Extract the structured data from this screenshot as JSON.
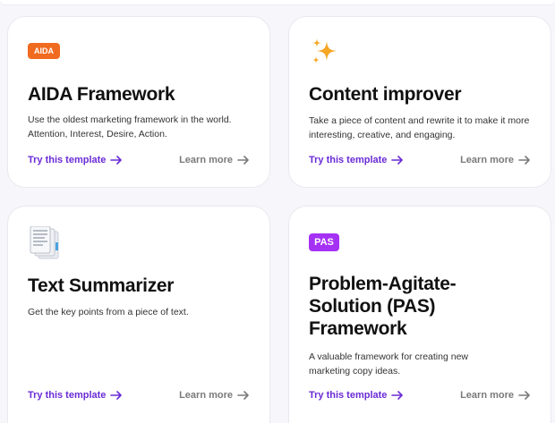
{
  "cards": [
    {
      "badge": "AIDA",
      "icon": "aida-badge-icon",
      "title": "AIDA Framework",
      "description": "Use the oldest marketing framework in the world. Attention, Interest, Desire, Action.",
      "try_label": "Try this template",
      "learn_label": "Learn more"
    },
    {
      "icon": "sparkles-icon",
      "title": "Content improver",
      "description": "Take a piece of content and rewrite it to make it more interesting, creative, and engaging.",
      "try_label": "Try this template",
      "learn_label": "Learn more"
    },
    {
      "icon": "document-stack-icon",
      "title": "Text Summarizer",
      "description": "Get the key points from a piece of text.",
      "try_label": "Try this template",
      "learn_label": "Learn more"
    },
    {
      "badge": "PAS",
      "icon": "pas-badge-icon",
      "title": "Problem-Agitate-Solution (PAS) Framework",
      "description": "A valuable framework for creating new marketing copy ideas.",
      "try_label": "Try this template",
      "learn_label": "Learn more"
    }
  ],
  "colors": {
    "accent": "#6a2bd6",
    "muted_link": "#7a7a7a",
    "aida_badge": "#f06a1f",
    "pas_badge": "#a531f5",
    "sparkle": "#f5a623"
  }
}
